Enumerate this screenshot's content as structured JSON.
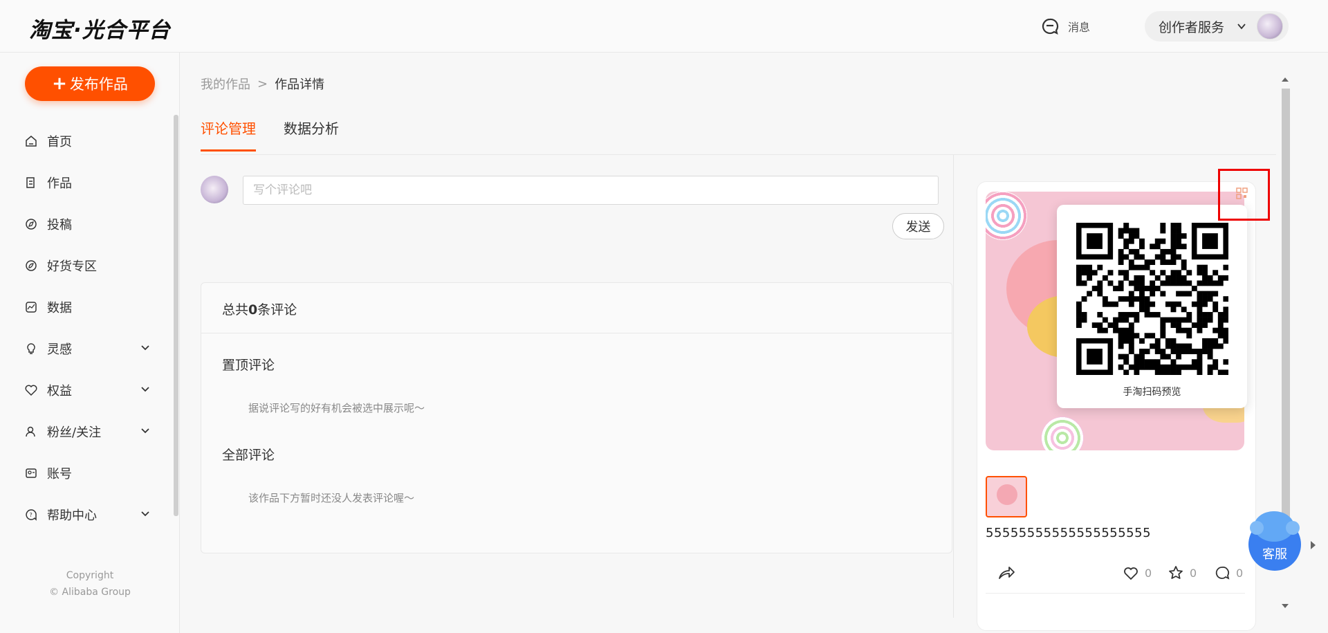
{
  "header": {
    "logo": "淘宝·光合平台",
    "message_label": "消息",
    "creator_service": "创作者服务"
  },
  "sidebar": {
    "publish_label": "发布作品",
    "items": [
      {
        "label": "首页",
        "icon": "home-icon",
        "expandable": false
      },
      {
        "label": "作品",
        "icon": "works-icon",
        "expandable": false
      },
      {
        "label": "投稿",
        "icon": "compass-icon",
        "expandable": false
      },
      {
        "label": "好货专区",
        "icon": "tag-icon",
        "expandable": false
      },
      {
        "label": "数据",
        "icon": "chart-icon",
        "expandable": false
      },
      {
        "label": "灵感",
        "icon": "lightbulb-icon",
        "expandable": true
      },
      {
        "label": "权益",
        "icon": "heart-shield-icon",
        "expandable": true
      },
      {
        "label": "粉丝/关注",
        "icon": "user-icon",
        "expandable": true
      },
      {
        "label": "账号",
        "icon": "id-card-icon",
        "expandable": false
      },
      {
        "label": "帮助中心",
        "icon": "help-icon",
        "expandable": true
      }
    ],
    "copyright_line1": "Copyright",
    "copyright_line2": "© Alibaba Group"
  },
  "breadcrumb": {
    "parent": "我的作品",
    "separator": ">",
    "current": "作品详情"
  },
  "tabs": [
    {
      "label": "评论管理",
      "active": true
    },
    {
      "label": "数据分析",
      "active": false
    }
  ],
  "comment_form": {
    "placeholder": "写个评论吧",
    "value": "",
    "send_label": "发送"
  },
  "comments": {
    "total_prefix": "总共",
    "total_count": "0",
    "total_suffix": "条评论",
    "pinned_title": "置顶评论",
    "pinned_empty": "据说评论写的好有机会被选中展示呢～",
    "all_title": "全部评论",
    "all_empty": "该作品下方暂时还没人发表评论喔～"
  },
  "preview": {
    "qr_caption": "手淘扫码预览",
    "work_title": "55555555555555555555",
    "likes": "0",
    "favorites": "0",
    "comments": "0"
  },
  "customer_service": {
    "label": "客服"
  },
  "colors": {
    "accent": "#ff5000",
    "highlight": "#e00000",
    "cs_blue": "#3a7ff0"
  }
}
